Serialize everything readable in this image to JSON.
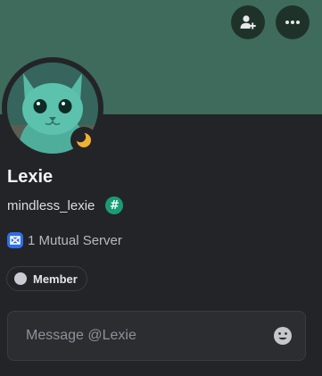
{
  "profile": {
    "display_name": "Lexie",
    "username": "mindless_lexie",
    "banner_color": "#3f6b5c",
    "avatar": "cat-avatar",
    "status_icon": "moon-icon",
    "status": "idle",
    "badge_icon": "hash-badge-icon"
  },
  "actions": {
    "add_friend_icon": "add-friend-icon",
    "more_icon": "more-icon"
  },
  "mutual": {
    "icon": "server-icon",
    "text": "1 Mutual Server"
  },
  "roles": [
    {
      "label": "Member",
      "color": "#c8ccd2"
    }
  ],
  "message": {
    "placeholder": "Message @Lexie",
    "emoji_icon": "emoji-icon"
  }
}
